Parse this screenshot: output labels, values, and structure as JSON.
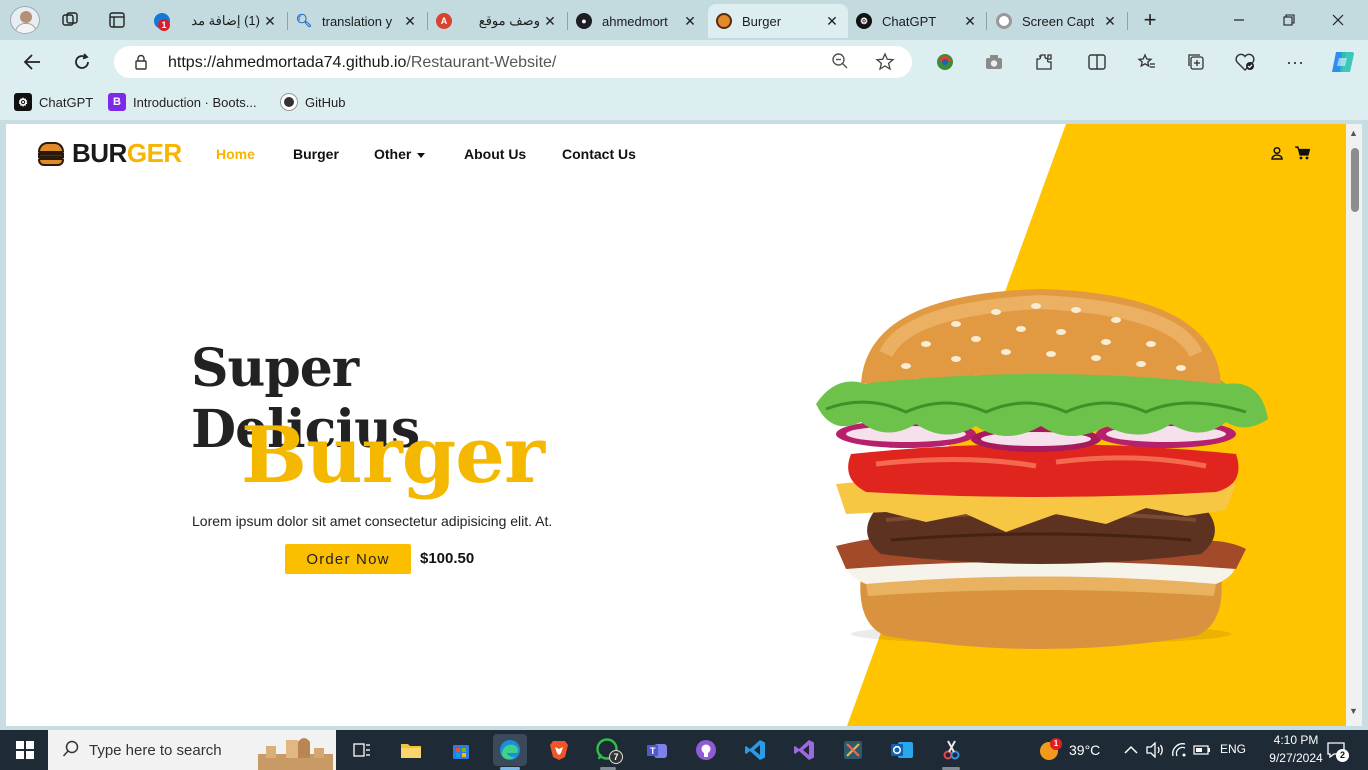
{
  "browser": {
    "tabs": [
      {
        "title": "(1) إضافة مد",
        "favicon": "notification-icon",
        "active": false
      },
      {
        "title": "translation y",
        "favicon": "search-icon",
        "active": false
      },
      {
        "title": "وصف موقع",
        "favicon": "app-icon",
        "active": false
      },
      {
        "title": "ahmedmort",
        "favicon": "github-icon",
        "active": false
      },
      {
        "title": "Burger",
        "favicon": "burger-icon",
        "active": true
      },
      {
        "title": "ChatGPT",
        "favicon": "chatgpt-icon",
        "active": false
      },
      {
        "title": "Screen Capt",
        "favicon": "capture-icon",
        "active": false
      }
    ],
    "tab_badge": "1",
    "address": {
      "host": "https://ahmedmortada74.github.io",
      "path": "/Restaurant-Website/"
    },
    "bookmarks": [
      {
        "label": "ChatGPT",
        "icon": "chatgpt-icon"
      },
      {
        "label": "Introduction · Boots...",
        "icon": "bootstrap-icon"
      },
      {
        "label": "GitHub",
        "icon": "github-icon"
      }
    ]
  },
  "site": {
    "brand": {
      "part1": "BUR",
      "part2": "GER"
    },
    "nav": [
      {
        "label": "Home",
        "active": true
      },
      {
        "label": "Burger",
        "active": false
      },
      {
        "label": "Other",
        "active": false,
        "dropdown": true
      },
      {
        "label": "About Us",
        "active": false
      },
      {
        "label": "Contact Us",
        "active": false
      }
    ],
    "hero": {
      "line1": "Super Delicius",
      "line2": "Burger",
      "text": "Lorem ipsum dolor sit amet consectetur adipisicing elit. At.",
      "button": "Order Now",
      "price": "$100.50"
    },
    "colors": {
      "accent": "#ffc300",
      "dark": "#222222"
    }
  },
  "taskbar": {
    "search_placeholder": "Type here to search",
    "weather": "39°C",
    "weather_badge": "1",
    "language": "ENG",
    "time": "4:10 PM",
    "date": "9/27/2024",
    "notifications": "2",
    "whatsapp_badge": "7"
  }
}
